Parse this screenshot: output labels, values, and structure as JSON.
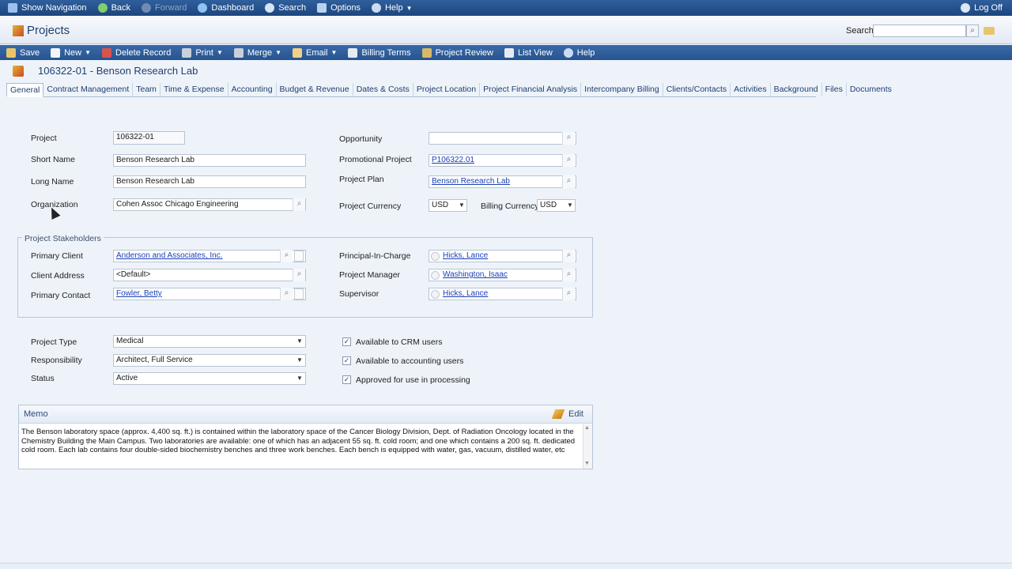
{
  "topnav": {
    "show_navigation": "Show Navigation",
    "back": "Back",
    "forward": "Forward",
    "dashboard": "Dashboard",
    "search": "Search",
    "options": "Options",
    "help": "Help",
    "logoff": "Log Off"
  },
  "titlebar": {
    "title": "Projects",
    "search_label": "Search",
    "search_value": ""
  },
  "toolbar": {
    "save": "Save",
    "new": "New",
    "delete_record": "Delete Record",
    "print": "Print",
    "merge": "Merge",
    "email": "Email",
    "billing_terms": "Billing Terms",
    "project_review": "Project Review",
    "list_view": "List View",
    "help": "Help"
  },
  "record": {
    "title": "106322-01 - Benson Research Lab"
  },
  "tabs": [
    "General",
    "Contract Management",
    "Team",
    "Time & Expense",
    "Accounting",
    "Budget & Revenue",
    "Dates & Costs",
    "Project Location",
    "Project Financial Analysis",
    "Intercompany Billing",
    "Clients/Contacts",
    "Activities",
    "Background",
    "Files",
    "Documents"
  ],
  "form": {
    "project_label": "Project",
    "project_value": "106322-01",
    "short_name_label": "Short Name",
    "short_name_value": "Benson Research Lab",
    "long_name_label": "Long Name",
    "long_name_value": "Benson Research Lab",
    "organization_label": "Organization",
    "organization_value": "Cohen Assoc Chicago Engineering",
    "opportunity_label": "Opportunity",
    "opportunity_value": "",
    "promotional_project_label": "Promotional Project",
    "promotional_project_value": "P106322.01",
    "project_plan_label": "Project Plan",
    "project_plan_value": "Benson Research Lab",
    "project_currency_label": "Project Currency",
    "project_currency_value": "USD",
    "billing_currency_label": "Billing Currency",
    "billing_currency_value": "USD"
  },
  "stakeholders": {
    "group_label": "Project Stakeholders",
    "primary_client_label": "Primary Client",
    "primary_client_value": "Anderson and Associates, Inc.",
    "client_address_label": "Client Address",
    "client_address_value": "<Default>",
    "primary_contact_label": "Primary Contact",
    "primary_contact_value": "Fowler, Betty",
    "principal_label": "Principal-In-Charge",
    "principal_value": "Hicks, Lance",
    "manager_label": "Project Manager",
    "manager_value": "Washington, Isaac",
    "supervisor_label": "Supervisor",
    "supervisor_value": "Hicks, Lance"
  },
  "classification": {
    "project_type_label": "Project Type",
    "project_type_value": "Medical",
    "responsibility_label": "Responsibility",
    "responsibility_value": "Architect, Full Service",
    "status_label": "Status",
    "status_value": "Active",
    "crm_label": "Available to CRM users",
    "accounting_label": "Available to accounting users",
    "processing_label": "Approved for use in processing",
    "check_mark": "✓"
  },
  "memo": {
    "title": "Memo",
    "edit": "Edit",
    "text": "The Benson laboratory space (approx. 4,400 sq. ft.) is contained within the laboratory space of the Cancer Biology Division, Dept. of Radiation Oncology located in the Chemistry Building the Main Campus.  Two laboratories are available: one of which has an adjacent 55 sq. ft. cold room; and one which contains a 200 sq. ft. dedicated cold room.  Each lab contains four double-sided biochemistry benches and three work benches.  Each bench is equipped with water, gas, vacuum, distilled water, etc"
  },
  "colors": {
    "nav_bg": "#2f5f9c",
    "toolbar_bg": "#3a6aa8",
    "link": "#1a3fb5",
    "page_bg": "#eef3fa"
  }
}
